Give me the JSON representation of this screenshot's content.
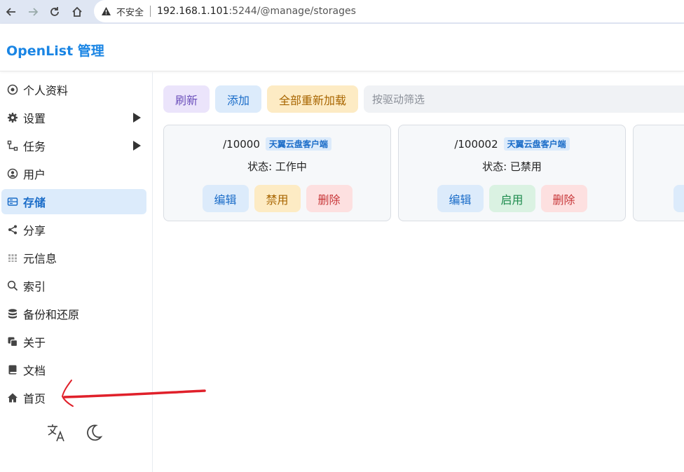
{
  "browser": {
    "insecure_label": "不安全",
    "url_host": "192.168.1.101",
    "url_path": ":5244/@manage/storages"
  },
  "app": {
    "brand": "OpenList 管理"
  },
  "sidebar": {
    "items": [
      {
        "label": "个人资料",
        "icon": "profile-icon"
      },
      {
        "label": "设置",
        "icon": "gear-icon",
        "expandable": true
      },
      {
        "label": "任务",
        "icon": "task-icon",
        "expandable": true
      },
      {
        "label": "用户",
        "icon": "user-icon"
      },
      {
        "label": "存储",
        "icon": "storage-icon",
        "active": true
      },
      {
        "label": "分享",
        "icon": "share-icon"
      },
      {
        "label": "元信息",
        "icon": "meta-icon"
      },
      {
        "label": "索引",
        "icon": "search-icon"
      },
      {
        "label": "备份和还原",
        "icon": "database-icon"
      },
      {
        "label": "关于",
        "icon": "copy-icon"
      },
      {
        "label": "文档",
        "icon": "book-icon"
      },
      {
        "label": "首页",
        "icon": "home-icon"
      }
    ],
    "bottom_icons": [
      "translate-icon",
      "moon-icon"
    ]
  },
  "toolbar": {
    "refresh": "刷新",
    "add": "添加",
    "reload_all": "全部重新加载",
    "filter_placeholder": "按驱动筛选"
  },
  "storages": [
    {
      "path": "/10000",
      "driver": "天翼云盘客户端",
      "status": "状态: 工作中",
      "actions": {
        "edit": "编辑",
        "toggle": "禁用",
        "delete": "删除"
      }
    },
    {
      "path": "/100002",
      "driver": "天翼云盘客户端",
      "status": "状态: 已禁用",
      "actions": {
        "edit": "编辑",
        "toggle": "启用",
        "delete": "删除"
      }
    }
  ],
  "colors": {
    "accent": "#1a85e4",
    "active_bg": "#dcebfb",
    "annotation": "#e0202a"
  }
}
